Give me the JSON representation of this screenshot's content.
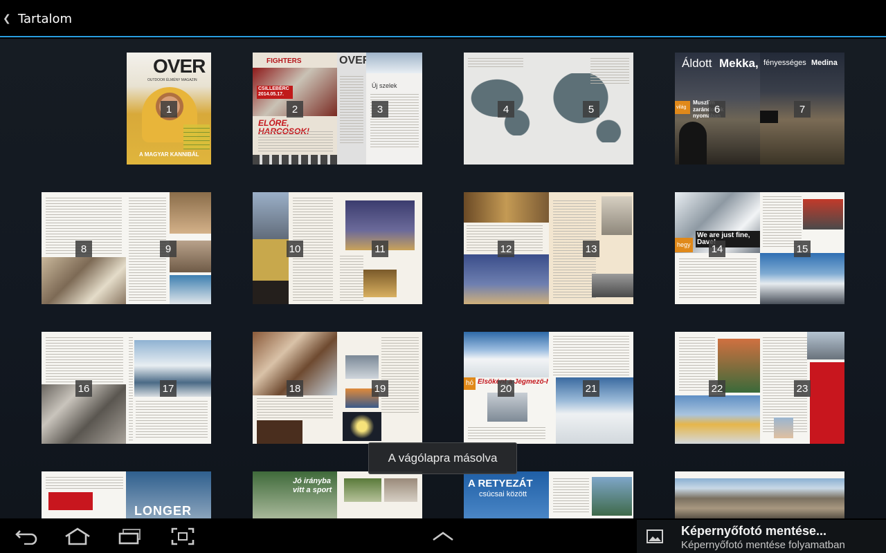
{
  "actionbar": {
    "title": "Tartalom"
  },
  "toast": {
    "text": "A vágólapra másolva"
  },
  "notification": {
    "title": "Képernyőfotó mentése...",
    "subtitle": "Képernyőfotó mentése folyamatban",
    "icon": "image-icon"
  },
  "navbar": {
    "icons": [
      "back-icon",
      "home-icon",
      "recent-apps-icon",
      "screenshot-icon",
      "chevron-up-icon"
    ]
  },
  "covers": {
    "p1": {
      "logo": "OVER",
      "tag": "OUTDOOR ÉLMÉNY MAGAZIN",
      "headline": "A MAGYAR KANNIBÁL"
    },
    "p2": {
      "brand": "FIGHTERS",
      "date": "CSILLEBÉRC 2014.05.17.",
      "headline": "ELŐRE, HARCOSOK!"
    },
    "p3": {
      "logo": "OVER",
      "section": "Új szelek"
    },
    "p6": {
      "title_a": "Áldott",
      "title_b": "Mekka,",
      "title_c": "fényességes",
      "title_d": "Medina",
      "badge": "világ",
      "sub": "Muszlim zarándokok nyomában"
    },
    "p14": {
      "badge": "hegy",
      "headline": "We are just fine, Dave!"
    },
    "p20": {
      "badge": "hó",
      "headline": "Elsőként a Jégmező-hágónak"
    },
    "p28": {
      "headline": "LONGER"
    },
    "p30": {
      "headline": "Jó irányba vitt a sport"
    },
    "p32": {
      "headline": "A RETYEZÁT",
      "sub": "csúcsai között"
    }
  },
  "pages": [
    "1",
    "2",
    "3",
    "4",
    "5",
    "6",
    "7",
    "8",
    "9",
    "10",
    "11",
    "12",
    "13",
    "14",
    "15",
    "16",
    "17",
    "18",
    "19",
    "20",
    "21",
    "22",
    "23"
  ]
}
